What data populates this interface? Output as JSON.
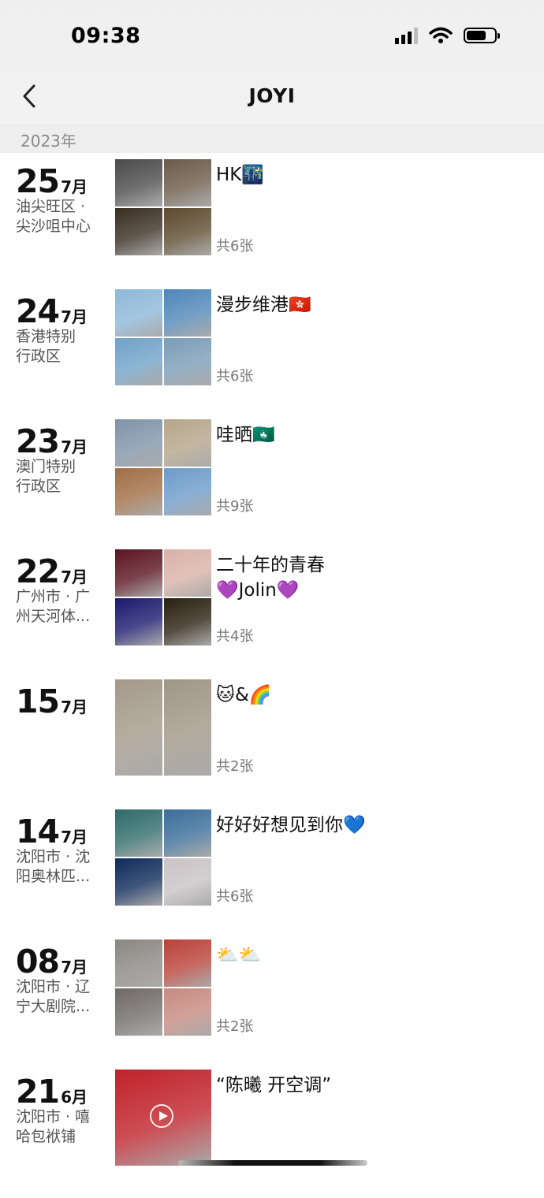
{
  "status_bar": {
    "time": "09:38"
  },
  "nav": {
    "title": "JOYI",
    "back_icon": "chevron-left-icon"
  },
  "year_header": "2023年",
  "entries": [
    {
      "day": "25",
      "month": "7月",
      "location": [
        "油尖旺区 ·",
        "尖沙咀中心"
      ],
      "caption": "HK🌃",
      "count": "共6张",
      "colors": [
        "#4a4a4a",
        "#6b5a48",
        "#3a2e22",
        "#5c4a2f"
      ]
    },
    {
      "day": "24",
      "month": "7月",
      "location": [
        "香港特别",
        "行政区"
      ],
      "caption": "漫步维港🇭🇰",
      "count": "共6张",
      "colors": [
        "#8db8d8",
        "#4f87b8",
        "#6fa2c8",
        "#7a9cb6"
      ]
    },
    {
      "day": "23",
      "month": "7月",
      "location": [
        "澳门特别",
        "行政区"
      ],
      "caption": "哇晒🇲🇴",
      "count": "共9张",
      "colors": [
        "#7f93a8",
        "#b5a58a",
        "#a06e45",
        "#6d9bc9"
      ]
    },
    {
      "day": "22",
      "month": "7月",
      "location": [
        "广州市 · 广",
        "州天河体..."
      ],
      "caption": "二十年的青春\n💜Jolin💜",
      "count": "共4张",
      "colors": [
        "#5a1420",
        "#d9b2a8",
        "#1b1a6e",
        "#2a2010"
      ]
    },
    {
      "day": "15",
      "month": "7月",
      "location": [],
      "caption": "🐱&🌈",
      "count": "共2张",
      "colors": [
        "#a4998a",
        "#a09686"
      ]
    },
    {
      "day": "14",
      "month": "7月",
      "location": [
        "沈阳市 · 沈",
        "阳奥林匹..."
      ],
      "caption": "好好好想见到你💙",
      "count": "共6张",
      "colors": [
        "#2e6b6a",
        "#3a6d99",
        "#0f2b5a",
        "#c9c3c6"
      ]
    },
    {
      "day": "08",
      "month": "7月",
      "location": [
        "沈阳市 · 辽",
        "宁大剧院..."
      ],
      "caption": "⛅⛅",
      "count": "共2张",
      "colors": [
        "#8a8682",
        "#b9423a",
        "#6f6a66",
        "#c68a80"
      ]
    },
    {
      "day": "21",
      "month": "6月",
      "location": [
        "沈阳市 · 嘻",
        "哈包袱铺"
      ],
      "caption": "“陈曦 开空调”",
      "count": "",
      "colors": [
        "#c0222a"
      ]
    }
  ]
}
